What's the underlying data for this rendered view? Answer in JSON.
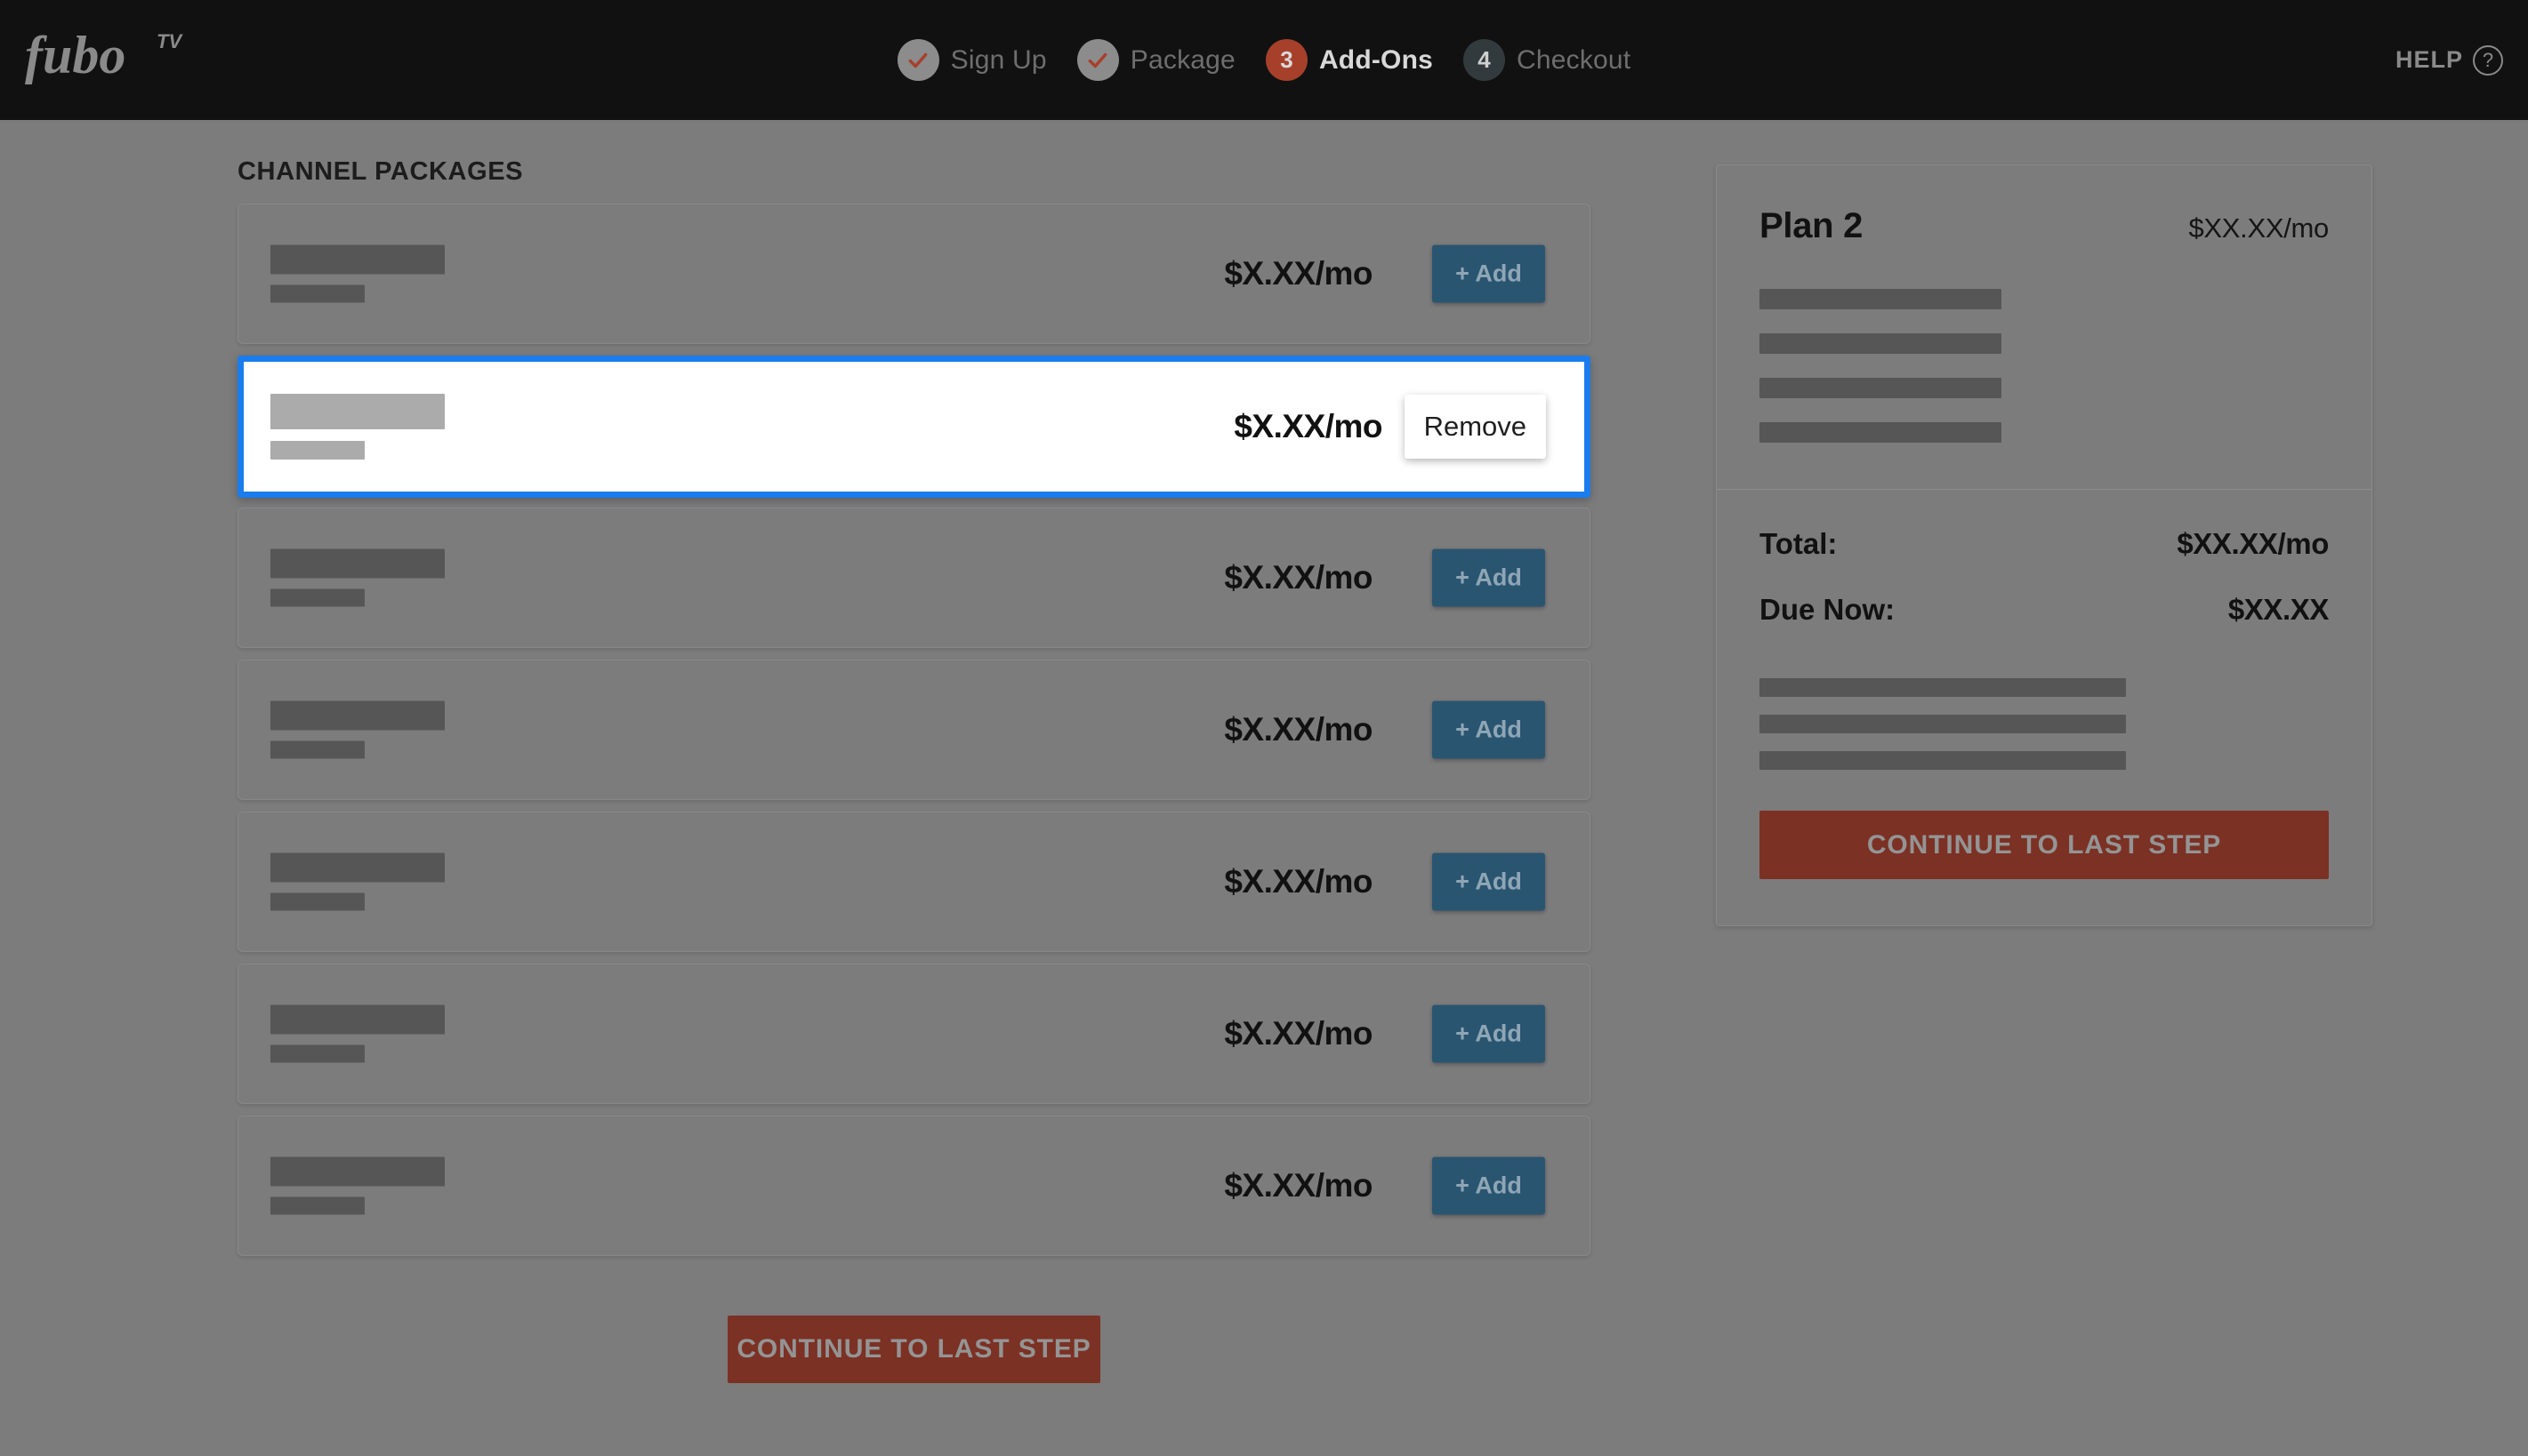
{
  "header": {
    "logo_text": "fuboTV",
    "logo_alt": "fubo",
    "logo_sup": "TV",
    "help_label": "HELP",
    "help_icon": "question-circle-icon",
    "steps": [
      {
        "number": "1",
        "label": "Sign Up",
        "state": "done",
        "icon": "check-icon"
      },
      {
        "number": "2",
        "label": "Package",
        "state": "done",
        "icon": "check-icon"
      },
      {
        "number": "3",
        "label": "Add-Ons",
        "state": "active",
        "icon": ""
      },
      {
        "number": "4",
        "label": "Checkout",
        "state": "pending",
        "icon": ""
      }
    ]
  },
  "main": {
    "section_title": "CHANNEL PACKAGES",
    "add_label": "+ Add",
    "remove_label": "Remove",
    "continue_label": "CONTINUE TO LAST STEP",
    "rows": [
      {
        "price": "$X.XX/mo",
        "state": "available",
        "action": "+ Add"
      },
      {
        "price": "$X.XX/mo",
        "state": "selected",
        "action": "Remove"
      },
      {
        "price": "$X.XX/mo",
        "state": "available",
        "action": "+ Add"
      },
      {
        "price": "$X.XX/mo",
        "state": "available",
        "action": "+ Add"
      },
      {
        "price": "$X.XX/mo",
        "state": "available",
        "action": "+ Add"
      },
      {
        "price": "$X.XX/mo",
        "state": "available",
        "action": "+ Add"
      },
      {
        "price": "$X.XX/mo",
        "state": "available",
        "action": "+ Add"
      }
    ]
  },
  "summary": {
    "plan_name": "Plan 2",
    "plan_price": "$XX.XX/mo",
    "total_label": "Total:",
    "total_value": "$XX.XX/mo",
    "due_now_label": "Due Now:",
    "due_now_value": "$XX.XX",
    "continue_label": "CONTINUE TO LAST STEP"
  },
  "colors": {
    "header_bg": "#111111",
    "page_overlay": "#7c7c7c",
    "accent_red": "#a6402b",
    "cta_red": "#7b3124",
    "add_blue": "#2a5571",
    "highlight_blue": "#1a7ced",
    "redact_dark": "#565656",
    "redact_light": "#ababab"
  }
}
